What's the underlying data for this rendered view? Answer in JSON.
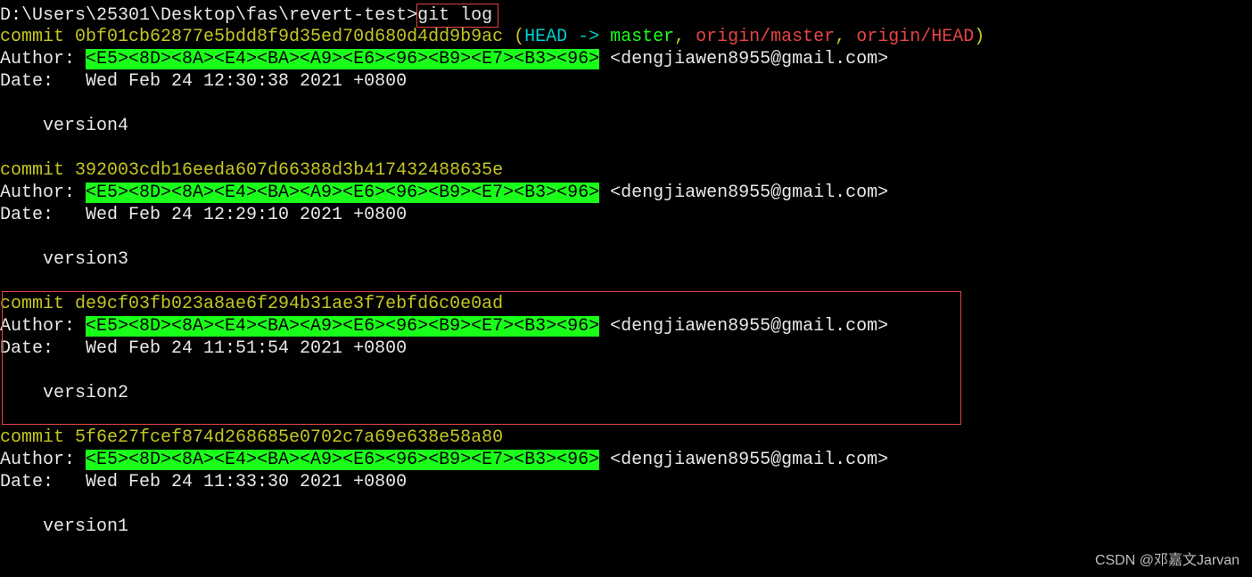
{
  "prompt": {
    "path": "D:\\Users\\25301\\Desktop\\fas\\revert-test>",
    "command": "git log"
  },
  "commits": {
    "c1": {
      "commit_label": "commit ",
      "hash": "0bf01cb62877e5bdd8f9d35ed70d680d4dd9b9ac",
      "refs_open": " (",
      "head_arrow": "HEAD -> ",
      "master": "master",
      "sep1": ", ",
      "origin_master": "origin/master",
      "sep2": ", ",
      "origin_head": "origin/HEAD",
      "refs_close": ")",
      "author_label": "Author: ",
      "author_encoded": "<E5><8D><8A><E4><BA><A9><E6><96><B9><E7><B3><96>",
      "author_email": " <dengjiawen8955@gmail.com>",
      "date_label": "Date:   ",
      "date": "Wed Feb 24 12:30:38 2021 +0800",
      "message": "version4"
    },
    "c2": {
      "commit_label": "commit ",
      "hash": "392003cdb16eeda607d66388d3b417432488635e",
      "author_label": "Author: ",
      "author_encoded": "<E5><8D><8A><E4><BA><A9><E6><96><B9><E7><B3><96>",
      "author_email": " <dengjiawen8955@gmail.com>",
      "date_label": "Date:   ",
      "date": "Wed Feb 24 12:29:10 2021 +0800",
      "message": "version3"
    },
    "c3": {
      "commit_label": "commit ",
      "hash": "de9cf03fb023a8ae6f294b31ae3f7ebfd6c0e0ad",
      "author_label": "Author: ",
      "author_encoded": "<E5><8D><8A><E4><BA><A9><E6><96><B9><E7><B3><96>",
      "author_email": " <dengjiawen8955@gmail.com>",
      "date_label": "Date:   ",
      "date": "Wed Feb 24 11:51:54 2021 +0800",
      "message": "version2"
    },
    "c4": {
      "commit_label": "commit ",
      "hash": "5f6e27fcef874d268685e0702c7a69e638e58a80",
      "author_label": "Author: ",
      "author_encoded": "<E5><8D><8A><E4><BA><A9><E6><96><B9><E7><B3><96>",
      "author_email": " <dengjiawen8955@gmail.com>",
      "date_label": "Date:   ",
      "date": "Wed Feb 24 11:33:30 2021 +0800",
      "message": "version1"
    }
  },
  "watermark": "CSDN @邓嘉文Jarvan"
}
